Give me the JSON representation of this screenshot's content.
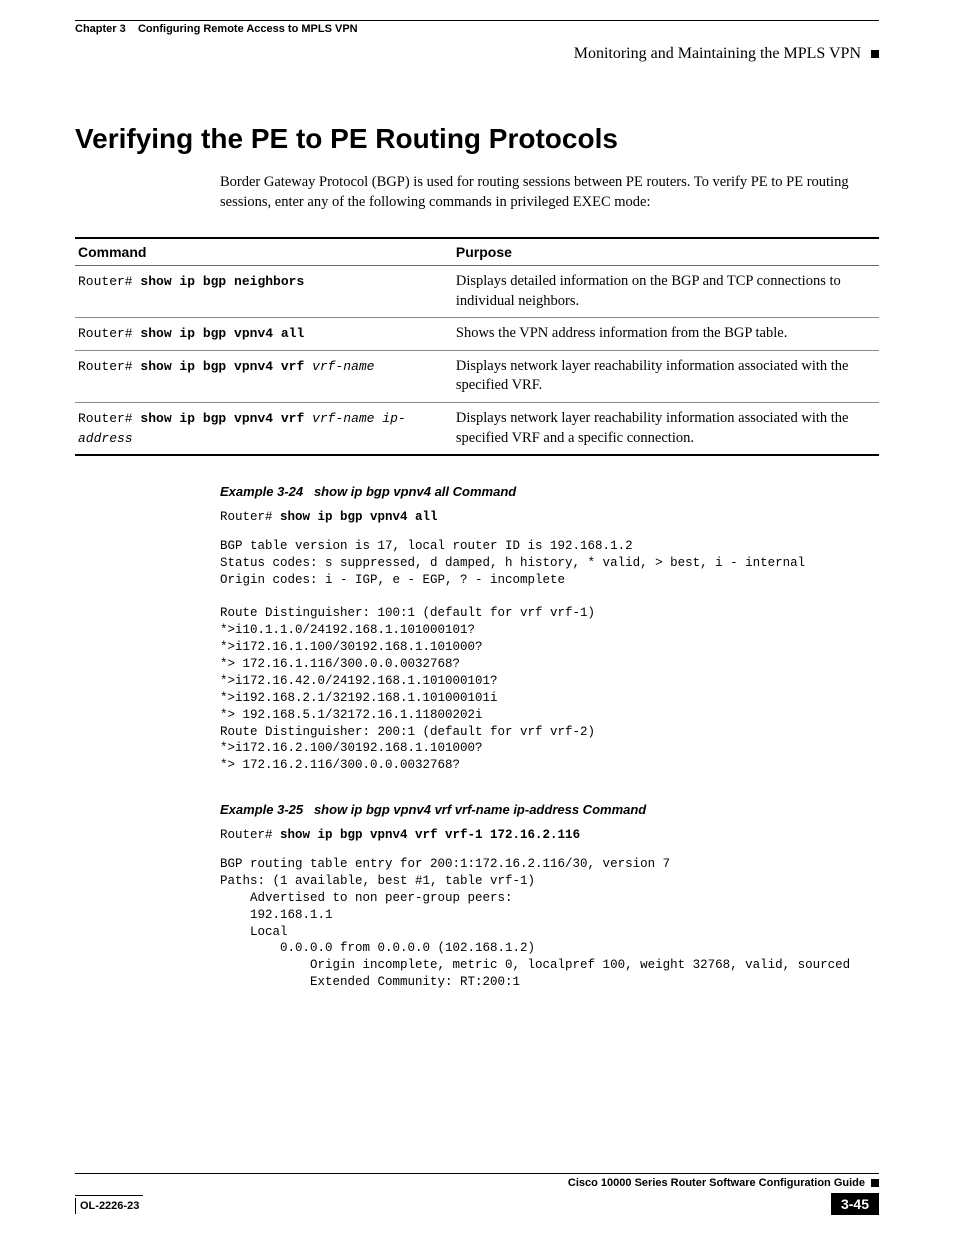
{
  "header": {
    "chapter_label": "Chapter 3",
    "chapter_title": "Configuring Remote Access to MPLS VPN",
    "section_title": "Monitoring and Maintaining the MPLS VPN"
  },
  "main": {
    "heading": "Verifying the PE to PE Routing Protocols",
    "intro": "Border Gateway Protocol (BGP) is used for routing sessions between PE routers. To verify PE to PE routing sessions, enter any of the following commands in privileged EXEC mode:"
  },
  "table": {
    "head_command": "Command",
    "head_purpose": "Purpose",
    "rows": [
      {
        "prefix": "Router# ",
        "bold": "show ip bgp neighbors",
        "italic": "",
        "purpose": "Displays detailed information on the BGP and TCP connections to individual neighbors."
      },
      {
        "prefix": "Router# ",
        "bold": "show ip bgp vpnv4 all",
        "italic": "",
        "purpose": "Shows the VPN address information from the BGP table."
      },
      {
        "prefix": "Router# ",
        "bold": "show ip bgp vpnv4 vrf ",
        "italic": "vrf-name",
        "purpose": "Displays network layer reachability information associated with the specified VRF."
      },
      {
        "prefix": "Router# ",
        "bold": "show ip bgp vpnv4 vrf ",
        "italic": "vrf-name ip-address",
        "purpose": "Displays network layer reachability information associated with the specified VRF and a specific connection."
      }
    ]
  },
  "example24": {
    "label": "Example 3-24",
    "title": "show ip bgp vpnv4 all Command",
    "prompt": "Router# ",
    "cmd": "show ip bgp vpnv4 all",
    "output": "BGP table version is 17, local router ID is 192.168.1.2\nStatus codes: s suppressed, d damped, h history, * valid, > best, i - internal\nOrigin codes: i - IGP, e - EGP, ? - incomplete\n\nRoute Distinguisher: 100:1 (default for vrf vrf-1)\n*>i10.1.1.0/24192.168.1.101000101?\n*>i172.16.1.100/30192.168.1.101000?\n*> 172.16.1.116/300.0.0.0032768?\n*>i172.16.42.0/24192.168.1.101000101?\n*>i192.168.2.1/32192.168.1.101000101i\n*> 192.168.5.1/32172.16.1.11800202i\nRoute Distinguisher: 200:1 (default for vrf vrf-2)\n*>i172.16.2.100/30192.168.1.101000?\n*> 172.16.2.116/300.0.0.0032768?"
  },
  "example25": {
    "label": "Example 3-25",
    "title": "show ip bgp vpnv4 vrf vrf-name ip-address Command",
    "prompt": "Router# ",
    "cmd": "show ip bgp vpnv4 vrf vrf-1 172.16.2.116",
    "output": "BGP routing table entry for 200:1:172.16.2.116/30, version 7\nPaths: (1 available, best #1, table vrf-1)\n    Advertised to non peer-group peers:\n    192.168.1.1\n    Local\n        0.0.0.0 from 0.0.0.0 (102.168.1.2)\n            Origin incomplete, metric 0, localpref 100, weight 32768, valid, sourced\n            Extended Community: RT:200:1"
  },
  "footer": {
    "guide": "Cisco 10000 Series Router Software Configuration Guide",
    "docnum": "OL-2226-23",
    "pagenum": "3-45"
  }
}
